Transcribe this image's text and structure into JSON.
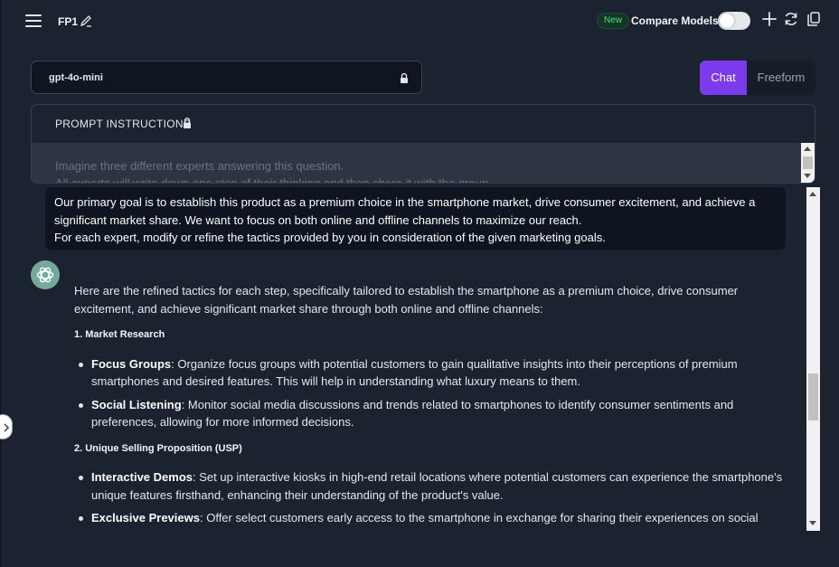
{
  "header": {
    "project_title": "FP1",
    "new_badge": "New",
    "compare_label": "Compare Models"
  },
  "model": {
    "name": "gpt-4o-mini"
  },
  "mode": {
    "chat_label": "Chat",
    "freeform_label": "Freeform",
    "active": "Chat"
  },
  "prompt": {
    "title": "PROMPT INSTRUCTIONS",
    "line1": "Imagine three different experts answering this question.",
    "line2": "All experts will write down one step of their thinking and then share it with the group."
  },
  "user_message": {
    "line1": "Our primary goal is to establish this product as a premium choice in the smartphone market, drive consumer excitement, and achieve a significant market share. We want to focus on both online and offline channels to maximize our reach.",
    "line2": "For each expert, modify or refine the tactics provided by you in consideration of the given marketing goals."
  },
  "assistant_message": {
    "intro": "Here are the refined tactics for each step, specifically tailored to establish the smartphone as a premium choice, drive consumer excitement, and achieve significant market share through both online and offline channels:",
    "sections": [
      {
        "heading": "1. Market Research",
        "items": [
          {
            "bold": "Focus Groups",
            "text": ": Organize focus groups with potential customers to gain qualitative insights into their perceptions of premium smartphones and desired features. This will help in understanding what luxury means to them."
          },
          {
            "bold": "Social Listening",
            "text": ": Monitor social media discussions and trends related to smartphones to identify consumer sentiments and preferences, allowing for more informed decisions."
          }
        ]
      },
      {
        "heading": "2. Unique Selling Proposition (USP)",
        "items": [
          {
            "bold": "Interactive Demos",
            "text": ": Set up interactive kiosks in high-end retail locations where potential customers can experience the smartphone's unique features firsthand, enhancing their understanding of the product's value."
          },
          {
            "bold": "Exclusive Previews",
            "text": ": Offer select customers early access to the smartphone in exchange for sharing their experiences on social media, creating buzz and authentic word-of-mouth marketing."
          }
        ]
      }
    ]
  },
  "colors": {
    "background": "#1b2230",
    "accent": "#7c3aed",
    "new_badge_text": "#4ade80",
    "avatar": "#74aa9c"
  },
  "icons": [
    "menu-icon",
    "pencil-icon",
    "plus-icon",
    "refresh-icon",
    "copy-icon",
    "lock-icon",
    "openai-logo-icon",
    "chevron-right-icon"
  ]
}
